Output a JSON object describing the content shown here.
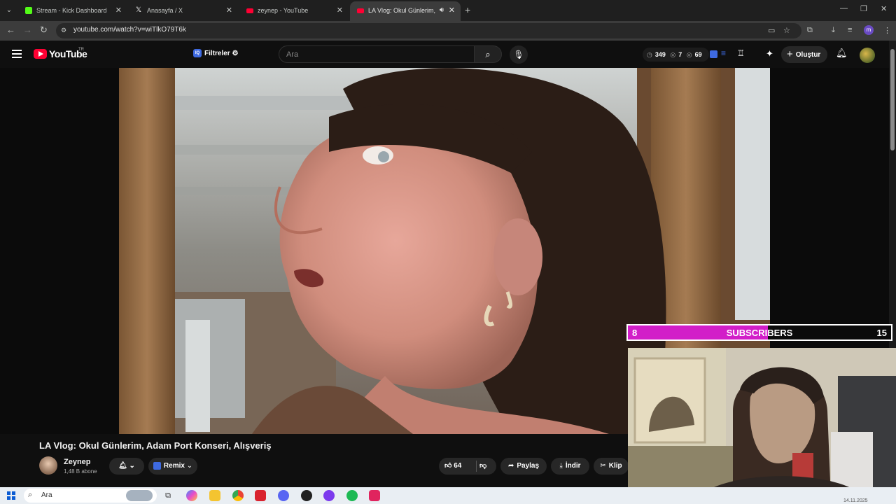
{
  "browser": {
    "tabs": [
      {
        "title": "Stream - Kick Dashboard",
        "icon": "kick-icon",
        "color": "#53fc18"
      },
      {
        "title": "Anasayfa / X",
        "icon": "x-icon",
        "color": "#ffffff"
      },
      {
        "title": "zeynep - YouTube",
        "icon": "youtube-icon",
        "color": "#ff0033"
      },
      {
        "title": "LA Vlog: Okul Günlerim, Ad",
        "icon": "youtube-icon",
        "color": "#ff0033",
        "active": true
      }
    ],
    "url": "youtube.com/watch?v=wiTlkO79T6k",
    "profile_initial": "m"
  },
  "youtube": {
    "wordmark": "YouTube",
    "country": "TR",
    "filters_label": "Filtreler",
    "filters_badge": "IQ",
    "search_placeholder": "Ara",
    "stats": {
      "views": "349",
      "comments": "7",
      "likes": "69"
    },
    "create_label": "Oluştur"
  },
  "video": {
    "title": "LA Vlog: Okul Günlerim, Adam Port Konseri, Alışveriş",
    "channel_name": "Zeynep",
    "channel_subs": "1,48 B abone",
    "remix_label": "Remix",
    "like_count": "64",
    "share_label": "Paylaş",
    "download_label": "İndir",
    "clip_label": "Klip"
  },
  "overlay": {
    "sub_current": "8",
    "sub_label": "SUBSCRIBERS",
    "sub_goal": "15",
    "progress_fraction": 0.533,
    "bar_color": "#d21ec8"
  },
  "taskbar": {
    "search_placeholder": "Ara",
    "date": "14.11.2025"
  }
}
